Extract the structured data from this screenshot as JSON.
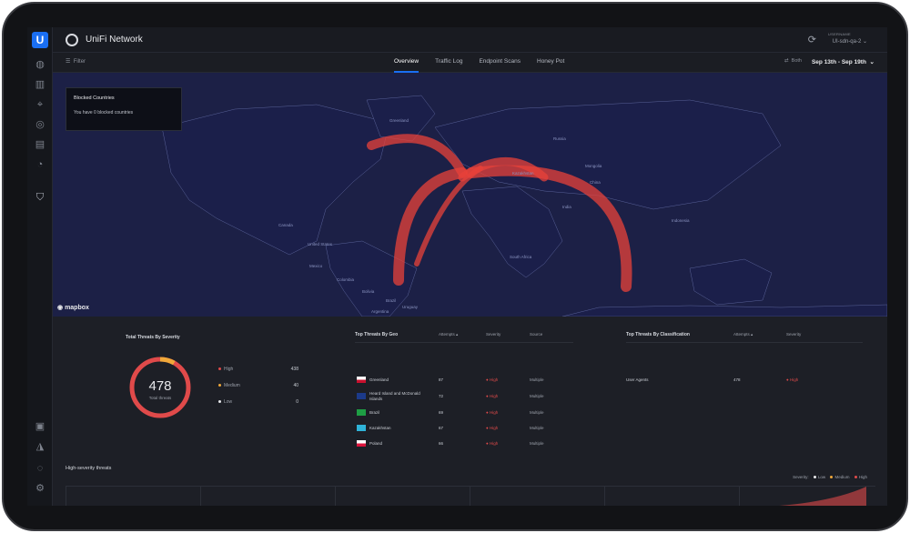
{
  "app": {
    "title": "UniFi Network",
    "logo_letter": "U"
  },
  "user": {
    "label": "USERNAME",
    "name": "UI-sdn-qa-2"
  },
  "subbar": {
    "filter_label": "Filter",
    "tabs": [
      {
        "label": "Overview",
        "active": true
      },
      {
        "label": "Traffic Log",
        "active": false
      },
      {
        "label": "Endpoint Scans",
        "active": false
      },
      {
        "label": "Honey Pot",
        "active": false
      }
    ],
    "direction_label": "Both",
    "date_range": "Sep 13th - Sep 19th"
  },
  "map": {
    "blocked_title": "Blocked Countries",
    "blocked_text": "You have 0 blocked countries",
    "attribution": "mapbox",
    "labels": [
      "Canada",
      "United States",
      "Mexico",
      "Colombia",
      "Brazil",
      "Bolivia",
      "Uruguay",
      "Argentina",
      "Greenland",
      "Russia",
      "China",
      "India",
      "Indonesia",
      "South Africa",
      "Kazakhstan",
      "Mongolia"
    ]
  },
  "severity_panel": {
    "title": "Total Threats By Severity",
    "total": "478",
    "total_label": "Total threats",
    "items": [
      {
        "label": "High",
        "value": "438",
        "color": "#e04a4a"
      },
      {
        "label": "Medium",
        "value": "40",
        "color": "#f0a83a"
      },
      {
        "label": "Low",
        "value": "0",
        "color": "#e8e9ec"
      }
    ]
  },
  "geo_panel": {
    "title": "Top Threats By Geo",
    "col_attempts": "Attempts",
    "col_severity": "Severity",
    "col_source": "Source",
    "rows": [
      {
        "country": "Greenland",
        "attempts": "87",
        "severity": "High",
        "source": "Multiple"
      },
      {
        "country": "Heard Island and McDonald Islands",
        "attempts": "72",
        "severity": "High",
        "source": "Multiple"
      },
      {
        "country": "Brazil",
        "attempts": "69",
        "severity": "High",
        "source": "Multiple"
      },
      {
        "country": "Kazakhstan",
        "attempts": "67",
        "severity": "High",
        "source": "Multiple"
      },
      {
        "country": "Poland",
        "attempts": "66",
        "severity": "High",
        "source": "Multiple"
      }
    ]
  },
  "class_panel": {
    "title": "Top Threats By Classification",
    "col_attempts": "Attempts",
    "col_severity": "Severity",
    "rows": [
      {
        "classification": "User Agents",
        "attempts": "478",
        "severity": "High"
      }
    ]
  },
  "high_severity": {
    "title": "High-severity threats",
    "legend_label": "Severity:",
    "legend": [
      {
        "label": "Low",
        "color": "#e8e9ec"
      },
      {
        "label": "Medium",
        "color": "#f0a83a"
      },
      {
        "label": "High",
        "color": "#e04a4a"
      }
    ]
  }
}
